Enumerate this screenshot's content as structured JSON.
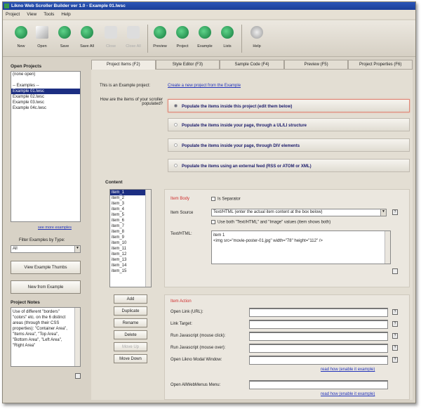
{
  "title": "Likno Web Scroller Builder ver 1.0 - Example 01.lwsc",
  "menu": [
    "Project",
    "View",
    "Tools",
    "Help"
  ],
  "toolbar": [
    "New",
    "Open",
    "Save",
    "Save All",
    "Close",
    "Close All",
    "Preview",
    "Project",
    "Example",
    "Lists",
    "Help"
  ],
  "left": {
    "open_projects_label": "Open Projects",
    "projects": [
      "(none open)",
      "",
      "-- Examples --",
      "Example 01.lwsc",
      "Example 02.lwsc",
      "Example 03.lwsc",
      "Example 04c.lwsc"
    ],
    "see_more": "see more examples",
    "filter_label": "Filter Examples by Type:",
    "filter_value": "All",
    "view_thumbs": "View Example Thumbs",
    "new_from_example": "New from Example",
    "notes_label": "Project Notes",
    "notes": "Use of different \"borders\" \"colors\" etc. on the 6 distinct areas (through their CSS properties): \"Container Area\", \"Items Area\", \"Top Area\", \"Bottom Area\", \"Left Area\", \"Right Area\""
  },
  "tabs": [
    "Project Items (F2)",
    "Style Editor (F3)",
    "Sample Code (F4)",
    "Preview (F5)",
    "Project Properties (F6)"
  ],
  "main": {
    "example_label": "This is an Example project:",
    "example_link": "Create a new project from the Example",
    "populate_question": "How are the items of your scroller populated?",
    "options": [
      "Populate the items inside this project (edit them below)",
      "Populate the items inside your page, through a UL/LI structure",
      "Populate the items inside your page, through DIV elements",
      "Populate the items using an external feed (RSS or ATOM or XML)"
    ],
    "content_label": "Content",
    "items": [
      "item_1",
      "item_2",
      "item_3",
      "item_4",
      "item_5",
      "item_6",
      "item_7",
      "item_8",
      "item_9",
      "item_10",
      "item_11",
      "item_12",
      "item_13",
      "item_14",
      "item_15"
    ],
    "buttons": [
      "Add",
      "Duplicate",
      "Rename",
      "Delete",
      "Move Up",
      "Move Down"
    ],
    "item_body": {
      "label": "Item Body",
      "separator": "Is Separator",
      "source_label": "Item Source",
      "source_value": "Text/HTML (enter the actual item content at the box below)",
      "use_both": "Use both \"Text/HTML\" and \"Image\" values (item shows both)",
      "text_label": "Text/HTML:",
      "text_value": "item 1\n<img src=\"movie-poster-01.jpg\" width=\"78\" height=\"112\" />"
    },
    "item_action": {
      "label": "Item Action",
      "fields": [
        "Open Link (URL):",
        "Link Target:",
        "Run Javascript (mouse click):",
        "Run Javascript (mouse over):",
        "Open Likno Modal Window:"
      ],
      "link1": "read how (enable it example)",
      "menu_label": "Open AllWebMenus Menu:",
      "link2": "read how (enable it example)"
    }
  }
}
